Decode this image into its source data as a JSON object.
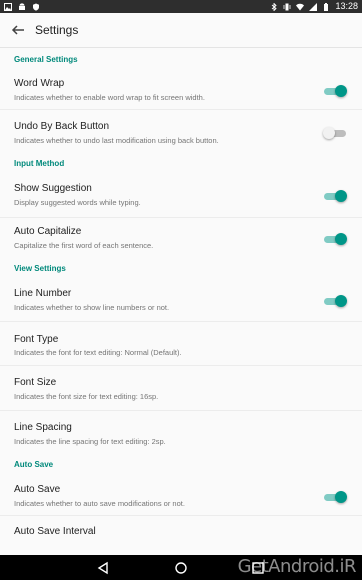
{
  "status_bar": {
    "time": "13:28"
  },
  "app_bar": {
    "title": "Settings"
  },
  "sections": [
    {
      "header": "General Settings",
      "items": [
        {
          "title": "Word Wrap",
          "subtitle": "Indicates whether to enable word wrap to fit screen width.",
          "toggle": true
        },
        {
          "title": "Undo By Back Button",
          "subtitle": "Indicates whether to undo last modification using back button.",
          "toggle": false
        }
      ]
    },
    {
      "header": "Input Method",
      "items": [
        {
          "title": "Show Suggestion",
          "subtitle": "Display suggested words while typing.",
          "toggle": true
        },
        {
          "title": "Auto Capitalize",
          "subtitle": "Capitalize the first word of each sentence.",
          "toggle": true
        }
      ]
    },
    {
      "header": "View Settings",
      "items": [
        {
          "title": "Line Number",
          "subtitle": "Indicates whether to show line numbers or not.",
          "toggle": true
        },
        {
          "title": "Font Type",
          "subtitle": "Indicates the font for text editing: Normal (Default)."
        },
        {
          "title": "Font Size",
          "subtitle": "Indicates the font size for text editing: 16sp."
        },
        {
          "title": "Line Spacing",
          "subtitle": "Indicates the line spacing for text editing: 2sp."
        }
      ]
    },
    {
      "header": "Auto Save",
      "items": [
        {
          "title": "Auto Save",
          "subtitle": "Indicates whether to auto save modifications or not.",
          "toggle": true
        },
        {
          "title": "Auto Save Interval",
          "subtitle": ""
        }
      ]
    }
  ],
  "watermark": "GetAndroid.iR",
  "colors": {
    "accent": "#009688",
    "accent_track": "#80cbc4",
    "section_header": "#00897b",
    "status_bar": "#2e2e2e",
    "nav_bar": "#000000"
  },
  "icons": [
    "image-icon",
    "android-icon",
    "shield-icon",
    "bluetooth-icon",
    "vibrate-icon",
    "wifi-icon",
    "signal-icon",
    "battery-icon",
    "back-arrow-icon",
    "nav-back-icon",
    "nav-home-icon",
    "nav-recents-icon"
  ]
}
